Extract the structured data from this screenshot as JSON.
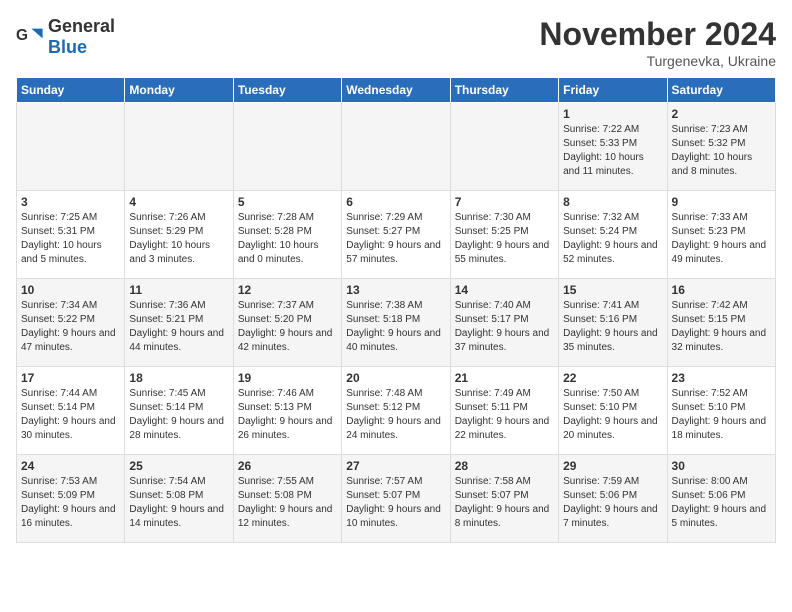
{
  "header": {
    "logo_general": "General",
    "logo_blue": "Blue",
    "month_title": "November 2024",
    "location": "Turgenevka, Ukraine"
  },
  "weekdays": [
    "Sunday",
    "Monday",
    "Tuesday",
    "Wednesday",
    "Thursday",
    "Friday",
    "Saturday"
  ],
  "weeks": [
    [
      {
        "day": "",
        "info": ""
      },
      {
        "day": "",
        "info": ""
      },
      {
        "day": "",
        "info": ""
      },
      {
        "day": "",
        "info": ""
      },
      {
        "day": "",
        "info": ""
      },
      {
        "day": "1",
        "info": "Sunrise: 7:22 AM\nSunset: 5:33 PM\nDaylight: 10 hours and 11 minutes."
      },
      {
        "day": "2",
        "info": "Sunrise: 7:23 AM\nSunset: 5:32 PM\nDaylight: 10 hours and 8 minutes."
      }
    ],
    [
      {
        "day": "3",
        "info": "Sunrise: 7:25 AM\nSunset: 5:31 PM\nDaylight: 10 hours and 5 minutes."
      },
      {
        "day": "4",
        "info": "Sunrise: 7:26 AM\nSunset: 5:29 PM\nDaylight: 10 hours and 3 minutes."
      },
      {
        "day": "5",
        "info": "Sunrise: 7:28 AM\nSunset: 5:28 PM\nDaylight: 10 hours and 0 minutes."
      },
      {
        "day": "6",
        "info": "Sunrise: 7:29 AM\nSunset: 5:27 PM\nDaylight: 9 hours and 57 minutes."
      },
      {
        "day": "7",
        "info": "Sunrise: 7:30 AM\nSunset: 5:25 PM\nDaylight: 9 hours and 55 minutes."
      },
      {
        "day": "8",
        "info": "Sunrise: 7:32 AM\nSunset: 5:24 PM\nDaylight: 9 hours and 52 minutes."
      },
      {
        "day": "9",
        "info": "Sunrise: 7:33 AM\nSunset: 5:23 PM\nDaylight: 9 hours and 49 minutes."
      }
    ],
    [
      {
        "day": "10",
        "info": "Sunrise: 7:34 AM\nSunset: 5:22 PM\nDaylight: 9 hours and 47 minutes."
      },
      {
        "day": "11",
        "info": "Sunrise: 7:36 AM\nSunset: 5:21 PM\nDaylight: 9 hours and 44 minutes."
      },
      {
        "day": "12",
        "info": "Sunrise: 7:37 AM\nSunset: 5:20 PM\nDaylight: 9 hours and 42 minutes."
      },
      {
        "day": "13",
        "info": "Sunrise: 7:38 AM\nSunset: 5:18 PM\nDaylight: 9 hours and 40 minutes."
      },
      {
        "day": "14",
        "info": "Sunrise: 7:40 AM\nSunset: 5:17 PM\nDaylight: 9 hours and 37 minutes."
      },
      {
        "day": "15",
        "info": "Sunrise: 7:41 AM\nSunset: 5:16 PM\nDaylight: 9 hours and 35 minutes."
      },
      {
        "day": "16",
        "info": "Sunrise: 7:42 AM\nSunset: 5:15 PM\nDaylight: 9 hours and 32 minutes."
      }
    ],
    [
      {
        "day": "17",
        "info": "Sunrise: 7:44 AM\nSunset: 5:14 PM\nDaylight: 9 hours and 30 minutes."
      },
      {
        "day": "18",
        "info": "Sunrise: 7:45 AM\nSunset: 5:14 PM\nDaylight: 9 hours and 28 minutes."
      },
      {
        "day": "19",
        "info": "Sunrise: 7:46 AM\nSunset: 5:13 PM\nDaylight: 9 hours and 26 minutes."
      },
      {
        "day": "20",
        "info": "Sunrise: 7:48 AM\nSunset: 5:12 PM\nDaylight: 9 hours and 24 minutes."
      },
      {
        "day": "21",
        "info": "Sunrise: 7:49 AM\nSunset: 5:11 PM\nDaylight: 9 hours and 22 minutes."
      },
      {
        "day": "22",
        "info": "Sunrise: 7:50 AM\nSunset: 5:10 PM\nDaylight: 9 hours and 20 minutes."
      },
      {
        "day": "23",
        "info": "Sunrise: 7:52 AM\nSunset: 5:10 PM\nDaylight: 9 hours and 18 minutes."
      }
    ],
    [
      {
        "day": "24",
        "info": "Sunrise: 7:53 AM\nSunset: 5:09 PM\nDaylight: 9 hours and 16 minutes."
      },
      {
        "day": "25",
        "info": "Sunrise: 7:54 AM\nSunset: 5:08 PM\nDaylight: 9 hours and 14 minutes."
      },
      {
        "day": "26",
        "info": "Sunrise: 7:55 AM\nSunset: 5:08 PM\nDaylight: 9 hours and 12 minutes."
      },
      {
        "day": "27",
        "info": "Sunrise: 7:57 AM\nSunset: 5:07 PM\nDaylight: 9 hours and 10 minutes."
      },
      {
        "day": "28",
        "info": "Sunrise: 7:58 AM\nSunset: 5:07 PM\nDaylight: 9 hours and 8 minutes."
      },
      {
        "day": "29",
        "info": "Sunrise: 7:59 AM\nSunset: 5:06 PM\nDaylight: 9 hours and 7 minutes."
      },
      {
        "day": "30",
        "info": "Sunrise: 8:00 AM\nSunset: 5:06 PM\nDaylight: 9 hours and 5 minutes."
      }
    ]
  ]
}
